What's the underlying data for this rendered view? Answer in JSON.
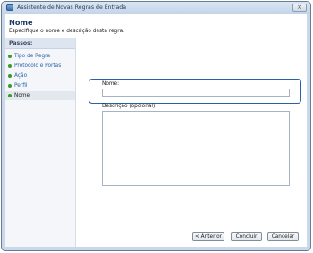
{
  "window": {
    "title": "Assistente de Novas Regras de Entrada",
    "close_symbol": "×"
  },
  "header": {
    "title": "Nome",
    "subtitle": "Especifique o nome e descrição desta regra."
  },
  "steps": {
    "heading": "Passos:",
    "items": [
      {
        "label": "Tipo de Regra",
        "active": false
      },
      {
        "label": "Protocolo e Portas",
        "active": false
      },
      {
        "label": "Ação",
        "active": false
      },
      {
        "label": "Perfil",
        "active": false
      },
      {
        "label": "Nome",
        "active": true
      }
    ]
  },
  "form": {
    "name_label": "Nome:",
    "name_value": "",
    "description_label": "Descrição (opcional):",
    "description_value": ""
  },
  "buttons": {
    "back": "< Anterior",
    "finish": "Concluir",
    "cancel": "Cancelar"
  },
  "colors": {
    "step_completed_dot": "#3a9a2a",
    "step_link": "#2a63a8",
    "focus_border": "#2d5ea8"
  }
}
